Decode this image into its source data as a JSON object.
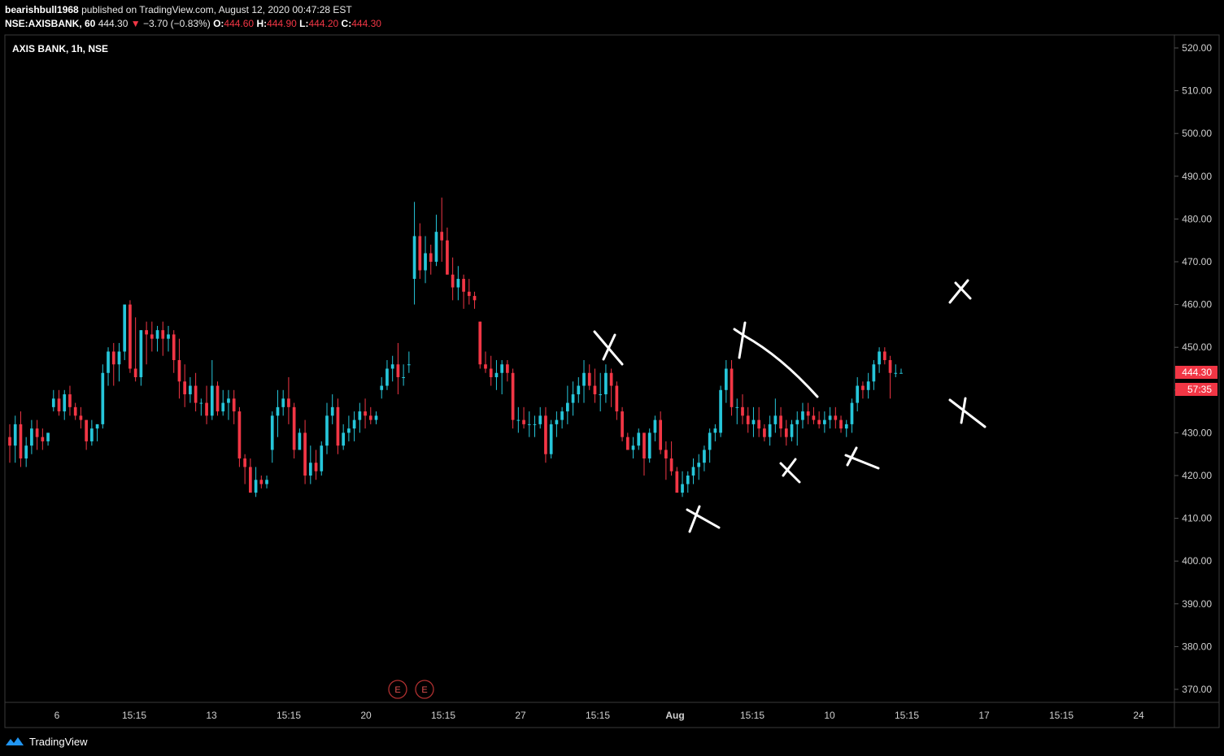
{
  "header": {
    "publisher": "bearishbull1968",
    "published_text": "published on TradingView.com, August 12, 2020 00:47:28 EST",
    "symbol": "NSE:AXISBANK, 60",
    "last": "444.30",
    "change": "−3.70 (−0.83%)",
    "open_label": "O:",
    "open": "444.60",
    "high_label": "H:",
    "high": "444.90",
    "low_label": "L:",
    "low": "444.20",
    "close_label": "C:",
    "close": "444.30"
  },
  "chart_title": "AXIS BANK, 1h, NSE",
  "footer": {
    "brand": "TradingView"
  },
  "colors": {
    "up": "#26c6da",
    "down": "#f23645",
    "background": "#000000",
    "grid": "#1a1a1a",
    "price_tag": "#f23645"
  },
  "chart_data": {
    "type": "candlestick",
    "y_axis": {
      "position": "right",
      "ylim": [
        365,
        525
      ],
      "ticks": [
        520,
        510,
        500,
        490,
        480,
        470,
        460,
        450,
        440,
        430,
        420,
        410,
        400,
        390,
        380,
        370
      ],
      "tick_labels": [
        "520.00",
        "510.00",
        "500.00",
        "490.00",
        "480.00",
        "470.00",
        "460.00",
        "450.00",
        "440.00",
        "430.00",
        "420.00",
        "410.00",
        "400.00",
        "390.00",
        "380.00",
        "370.00"
      ]
    },
    "x_axis": {
      "tick_labels": [
        "6",
        "15:15",
        "13",
        "15:15",
        "20",
        "15:15",
        "27",
        "15:15",
        "Aug",
        "15:15",
        "10",
        "15:15",
        "17",
        "15:15",
        "24"
      ],
      "bold_labels": [
        "Aug"
      ]
    },
    "last_price_label": "444.30",
    "countdown_label": "57:35",
    "event_markers": [
      {
        "label": "E"
      },
      {
        "label": "E"
      }
    ],
    "candles": [
      [
        429,
        432,
        423,
        427
      ],
      [
        427,
        434,
        423,
        432
      ],
      [
        432,
        435,
        422,
        424
      ],
      [
        424,
        429,
        422,
        427
      ],
      [
        427,
        433,
        425,
        431
      ],
      [
        431,
        433,
        426,
        429
      ],
      [
        429,
        431,
        426,
        428
      ],
      [
        428,
        430,
        427,
        430
      ],
      [
        436,
        440,
        435,
        438
      ],
      [
        438,
        440,
        434,
        435
      ],
      [
        435,
        440,
        433,
        439
      ],
      [
        439,
        441,
        434,
        436
      ],
      [
        436,
        437,
        433,
        434
      ],
      [
        434,
        436,
        431,
        433
      ],
      [
        433,
        433,
        426,
        428
      ],
      [
        428,
        433,
        427,
        431
      ],
      [
        431,
        432,
        428,
        432
      ],
      [
        432,
        446,
        431,
        444
      ],
      [
        444,
        450,
        441,
        449
      ],
      [
        449,
        451,
        441,
        446
      ],
      [
        446,
        451,
        442,
        449
      ],
      [
        449,
        460,
        447,
        460
      ],
      [
        460,
        461,
        444,
        445
      ],
      [
        445,
        457,
        442,
        443
      ],
      [
        443,
        454,
        441,
        454
      ],
      [
        454,
        456,
        446,
        453
      ],
      [
        453,
        456,
        449,
        452
      ],
      [
        452,
        455,
        449,
        454
      ],
      [
        454,
        456,
        448,
        452
      ],
      [
        452,
        455,
        449,
        453
      ],
      [
        453,
        454,
        444,
        447
      ],
      [
        447,
        452,
        438,
        442
      ],
      [
        442,
        446,
        436,
        439
      ],
      [
        439,
        443,
        437,
        441
      ],
      [
        441,
        444,
        435,
        437
      ],
      [
        437,
        438,
        434,
        437
      ],
      [
        437,
        441,
        432,
        434
      ],
      [
        434,
        447,
        433,
        441
      ],
      [
        441,
        442,
        434,
        435
      ],
      [
        435,
        440,
        434,
        437
      ],
      [
        437,
        440,
        433,
        438
      ],
      [
        438,
        440,
        432,
        435
      ],
      [
        435,
        436,
        422,
        424
      ],
      [
        424,
        425,
        418,
        422
      ],
      [
        422,
        424,
        416,
        416
      ],
      [
        416,
        422,
        415,
        419
      ],
      [
        419,
        420,
        417,
        418
      ],
      [
        418,
        420,
        417,
        419
      ],
      [
        426,
        435,
        423,
        434
      ],
      [
        434,
        440,
        429,
        436
      ],
      [
        436,
        440,
        434,
        438
      ],
      [
        438,
        443,
        432,
        436
      ],
      [
        436,
        437,
        424,
        426
      ],
      [
        426,
        431,
        426,
        430
      ],
      [
        430,
        433,
        418,
        420
      ],
      [
        420,
        427,
        418,
        423
      ],
      [
        423,
        426,
        419,
        421
      ],
      [
        421,
        428,
        420,
        427
      ],
      [
        427,
        437,
        425,
        434
      ],
      [
        434,
        439,
        432,
        436
      ],
      [
        436,
        438,
        425,
        427
      ],
      [
        427,
        432,
        426,
        430
      ],
      [
        430,
        434,
        428,
        431
      ],
      [
        431,
        435,
        428,
        433
      ],
      [
        433,
        437,
        430,
        435
      ],
      [
        435,
        438,
        431,
        434
      ],
      [
        434,
        436,
        432,
        433
      ],
      [
        433,
        435,
        432,
        434
      ],
      [
        440,
        443,
        438,
        441
      ],
      [
        441,
        447,
        440,
        445
      ],
      [
        445,
        448,
        442,
        446
      ],
      [
        446,
        451,
        439,
        443
      ],
      [
        443,
        446,
        441,
        443
      ],
      [
        446,
        449,
        444,
        446
      ],
      [
        466,
        484,
        460,
        476
      ],
      [
        476,
        479,
        466,
        468
      ],
      [
        468,
        476,
        465,
        472
      ],
      [
        472,
        474,
        467,
        470
      ],
      [
        470,
        481,
        469,
        477
      ],
      [
        477,
        485,
        470,
        475
      ],
      [
        475,
        478,
        467,
        467
      ],
      [
        467,
        471,
        461,
        464
      ],
      [
        464,
        469,
        461,
        466
      ],
      [
        466,
        467,
        459,
        463
      ],
      [
        463,
        466,
        460,
        462
      ],
      [
        462,
        463,
        459,
        461
      ],
      [
        456,
        456,
        445,
        446
      ],
      [
        446,
        449,
        444,
        445
      ],
      [
        445,
        448,
        441,
        443
      ],
      [
        443,
        447,
        440,
        444
      ],
      [
        444,
        447,
        439,
        446
      ],
      [
        446,
        447,
        442,
        444
      ],
      [
        444,
        445,
        431,
        433
      ],
      [
        433,
        436,
        430,
        433
      ],
      [
        433,
        436,
        431,
        432
      ],
      [
        432,
        435,
        429,
        432
      ],
      [
        432,
        434,
        429,
        432
      ],
      [
        432,
        436,
        431,
        434
      ],
      [
        434,
        436,
        423,
        425
      ],
      [
        425,
        433,
        424,
        432
      ],
      [
        432,
        435,
        429,
        433
      ],
      [
        433,
        436,
        431,
        435
      ],
      [
        435,
        441,
        432,
        437
      ],
      [
        437,
        442,
        434,
        439
      ],
      [
        439,
        443,
        437,
        441
      ],
      [
        441,
        447,
        437,
        444
      ],
      [
        444,
        446,
        440,
        441
      ],
      [
        441,
        445,
        437,
        439
      ],
      [
        439,
        444,
        435,
        439
      ],
      [
        439,
        446,
        437,
        444
      ],
      [
        444,
        445,
        436,
        441
      ],
      [
        441,
        442,
        433,
        435
      ],
      [
        435,
        436,
        428,
        429
      ],
      [
        429,
        430,
        426,
        426
      ],
      [
        426,
        429,
        424,
        427
      ],
      [
        427,
        431,
        426,
        430
      ],
      [
        430,
        430,
        420,
        424
      ],
      [
        424,
        431,
        423,
        430
      ],
      [
        430,
        434,
        428,
        433
      ],
      [
        433,
        435,
        425,
        426
      ],
      [
        426,
        428,
        419,
        424
      ],
      [
        424,
        428,
        420,
        421
      ],
      [
        421,
        422,
        416,
        416
      ],
      [
        416,
        421,
        415,
        418
      ],
      [
        418,
        421,
        416,
        420
      ],
      [
        420,
        424,
        418,
        422
      ],
      [
        422,
        425,
        419,
        423
      ],
      [
        423,
        427,
        421,
        426
      ],
      [
        426,
        431,
        423,
        430
      ],
      [
        430,
        432,
        428,
        431
      ],
      [
        430,
        441,
        429,
        440
      ],
      [
        440,
        447,
        437,
        445
      ],
      [
        445,
        447,
        434,
        436
      ],
      [
        436,
        438,
        432,
        436
      ],
      [
        436,
        439,
        432,
        434
      ],
      [
        434,
        436,
        430,
        432
      ],
      [
        432,
        436,
        429,
        433
      ],
      [
        433,
        436,
        429,
        431
      ],
      [
        431,
        432,
        428,
        429
      ],
      [
        429,
        434,
        427,
        432
      ],
      [
        432,
        438,
        430,
        434
      ],
      [
        434,
        436,
        429,
        431
      ],
      [
        431,
        433,
        427,
        429
      ],
      [
        429,
        433,
        428,
        432
      ],
      [
        432,
        435,
        427,
        433
      ],
      [
        433,
        437,
        431,
        435
      ],
      [
        435,
        437,
        432,
        434
      ],
      [
        434,
        436,
        432,
        433
      ],
      [
        433,
        435,
        431,
        432
      ],
      [
        432,
        435,
        430,
        433
      ],
      [
        433,
        436,
        431,
        434
      ],
      [
        434,
        436,
        431,
        433
      ],
      [
        433,
        434,
        430,
        431
      ],
      [
        431,
        433,
        429,
        432
      ],
      [
        432,
        438,
        430,
        437
      ],
      [
        437,
        443,
        435,
        441
      ],
      [
        441,
        442,
        438,
        440
      ],
      [
        440,
        444,
        438,
        442
      ],
      [
        442,
        447,
        440,
        446
      ],
      [
        446,
        450,
        444,
        449
      ],
      [
        449,
        450,
        446,
        447
      ],
      [
        447,
        448,
        438,
        444
      ],
      [
        444,
        446,
        443,
        444
      ],
      [
        444,
        445,
        444,
        444
      ]
    ]
  }
}
